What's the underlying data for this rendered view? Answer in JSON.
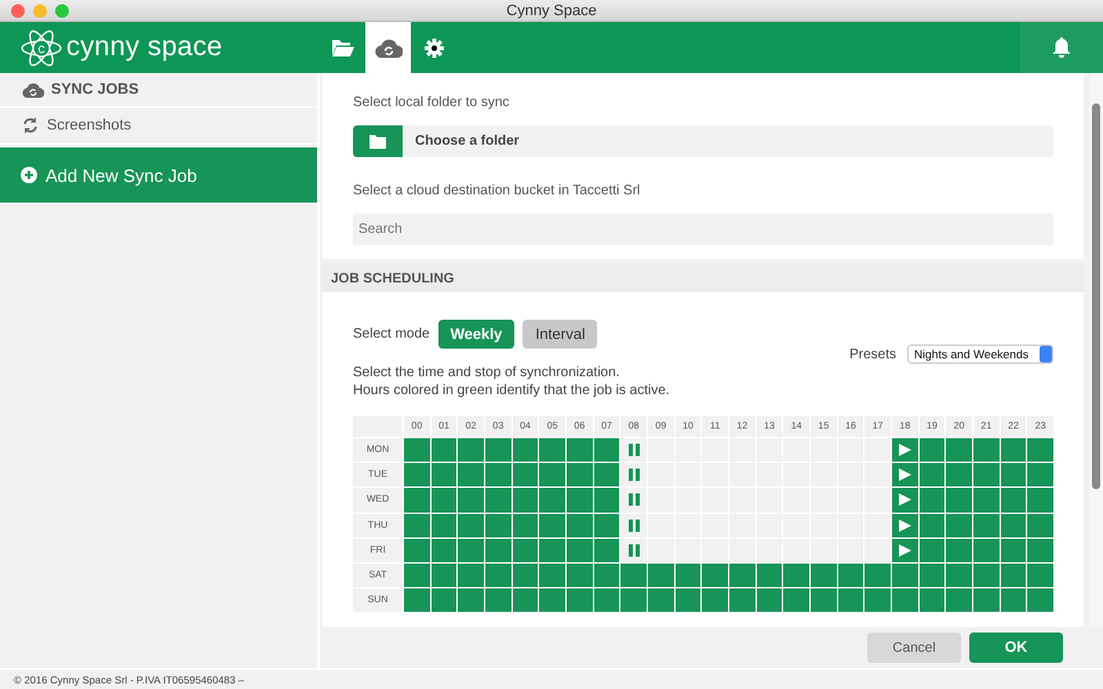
{
  "window": {
    "title": "Cynny Space"
  },
  "header": {
    "logo": {
      "mark": "c",
      "text": "cynny space"
    },
    "tabs": [
      {
        "kind": "folder",
        "selected": false
      },
      {
        "kind": "cloud",
        "selected": true
      },
      {
        "kind": "gear",
        "selected": false
      }
    ]
  },
  "sidebar": {
    "heading": "SYNC JOBS",
    "items": [
      {
        "label": "Screenshots",
        "selected": false
      }
    ],
    "add_button": "Add New Sync Job"
  },
  "source": {
    "folder_label": "Select local folder to sync",
    "folder_button": "Choose a folder",
    "bucket_label": "Select a cloud destination bucket in Taccetti Srl",
    "search": {
      "placeholder": "Search"
    }
  },
  "scheduling": {
    "title": "JOB SCHEDULING",
    "mode_label": "Select mode",
    "modes": [
      {
        "label": "Weekly",
        "selected": true
      },
      {
        "label": "Interval",
        "selected": false
      }
    ],
    "presets_label": "Presets",
    "preset": "Nights and Weekends",
    "description": [
      "Select the time and stop of synchronization.",
      "Hours colored in green identify that the job is active."
    ],
    "hours": [
      "00",
      "01",
      "02",
      "03",
      "04",
      "05",
      "06",
      "07",
      "08",
      "09",
      "10",
      "11",
      "12",
      "13",
      "14",
      "15",
      "16",
      "17",
      "18",
      "19",
      "20",
      "21",
      "22",
      "23"
    ],
    "rows": [
      {
        "day": "MON",
        "hours": [
          {
            "on": true
          },
          {
            "on": true
          },
          {
            "on": true
          },
          {
            "on": true
          },
          {
            "on": true
          },
          {
            "on": true
          },
          {
            "on": true
          },
          {
            "on": true
          },
          {
            "on": false,
            "kind": "stop"
          },
          {
            "on": false
          },
          {
            "on": false
          },
          {
            "on": false
          },
          {
            "on": false
          },
          {
            "on": false
          },
          {
            "on": false
          },
          {
            "on": false
          },
          {
            "on": false
          },
          {
            "on": false
          },
          {
            "on": true,
            "kind": "start"
          },
          {
            "on": true
          },
          {
            "on": true
          },
          {
            "on": true
          },
          {
            "on": true
          },
          {
            "on": true
          }
        ]
      },
      {
        "day": "TUE",
        "hours": [
          {
            "on": true
          },
          {
            "on": true
          },
          {
            "on": true
          },
          {
            "on": true
          },
          {
            "on": true
          },
          {
            "on": true
          },
          {
            "on": true
          },
          {
            "on": true
          },
          {
            "on": false,
            "kind": "stop"
          },
          {
            "on": false
          },
          {
            "on": false
          },
          {
            "on": false
          },
          {
            "on": false
          },
          {
            "on": false
          },
          {
            "on": false
          },
          {
            "on": false
          },
          {
            "on": false
          },
          {
            "on": false
          },
          {
            "on": true,
            "kind": "start"
          },
          {
            "on": true
          },
          {
            "on": true
          },
          {
            "on": true
          },
          {
            "on": true
          },
          {
            "on": true
          }
        ]
      },
      {
        "day": "WED",
        "hours": [
          {
            "on": true
          },
          {
            "on": true
          },
          {
            "on": true
          },
          {
            "on": true
          },
          {
            "on": true
          },
          {
            "on": true
          },
          {
            "on": true
          },
          {
            "on": true
          },
          {
            "on": false,
            "kind": "stop"
          },
          {
            "on": false
          },
          {
            "on": false
          },
          {
            "on": false
          },
          {
            "on": false
          },
          {
            "on": false
          },
          {
            "on": false
          },
          {
            "on": false
          },
          {
            "on": false
          },
          {
            "on": false
          },
          {
            "on": true,
            "kind": "start"
          },
          {
            "on": true
          },
          {
            "on": true
          },
          {
            "on": true
          },
          {
            "on": true
          },
          {
            "on": true
          }
        ]
      },
      {
        "day": "THU",
        "hours": [
          {
            "on": true
          },
          {
            "on": true
          },
          {
            "on": true
          },
          {
            "on": true
          },
          {
            "on": true
          },
          {
            "on": true
          },
          {
            "on": true
          },
          {
            "on": true
          },
          {
            "on": false,
            "kind": "stop"
          },
          {
            "on": false
          },
          {
            "on": false
          },
          {
            "on": false
          },
          {
            "on": false
          },
          {
            "on": false
          },
          {
            "on": false
          },
          {
            "on": false
          },
          {
            "on": false
          },
          {
            "on": false
          },
          {
            "on": true,
            "kind": "start"
          },
          {
            "on": true
          },
          {
            "on": true
          },
          {
            "on": true
          },
          {
            "on": true
          },
          {
            "on": true
          }
        ]
      },
      {
        "day": "FRI",
        "hours": [
          {
            "on": true
          },
          {
            "on": true
          },
          {
            "on": true
          },
          {
            "on": true
          },
          {
            "on": true
          },
          {
            "on": true
          },
          {
            "on": true
          },
          {
            "on": true
          },
          {
            "on": false,
            "kind": "stop"
          },
          {
            "on": false
          },
          {
            "on": false
          },
          {
            "on": false
          },
          {
            "on": false
          },
          {
            "on": false
          },
          {
            "on": false
          },
          {
            "on": false
          },
          {
            "on": false
          },
          {
            "on": false
          },
          {
            "on": true,
            "kind": "start"
          },
          {
            "on": true
          },
          {
            "on": true
          },
          {
            "on": true
          },
          {
            "on": true
          },
          {
            "on": true
          }
        ]
      },
      {
        "day": "SAT",
        "hours": [
          {
            "on": true
          },
          {
            "on": true
          },
          {
            "on": true
          },
          {
            "on": true
          },
          {
            "on": true
          },
          {
            "on": true
          },
          {
            "on": true
          },
          {
            "on": true
          },
          {
            "on": true
          },
          {
            "on": true
          },
          {
            "on": true
          },
          {
            "on": true
          },
          {
            "on": true
          },
          {
            "on": true
          },
          {
            "on": true
          },
          {
            "on": true
          },
          {
            "on": true
          },
          {
            "on": true
          },
          {
            "on": true
          },
          {
            "on": true
          },
          {
            "on": true
          },
          {
            "on": true
          },
          {
            "on": true
          },
          {
            "on": true
          }
        ]
      },
      {
        "day": "SUN",
        "hours": [
          {
            "on": true
          },
          {
            "on": true
          },
          {
            "on": true
          },
          {
            "on": true
          },
          {
            "on": true
          },
          {
            "on": true
          },
          {
            "on": true
          },
          {
            "on": true
          },
          {
            "on": true
          },
          {
            "on": true
          },
          {
            "on": true
          },
          {
            "on": true
          },
          {
            "on": true
          },
          {
            "on": true
          },
          {
            "on": true
          },
          {
            "on": true
          },
          {
            "on": true
          },
          {
            "on": true
          },
          {
            "on": true
          },
          {
            "on": true
          },
          {
            "on": true
          },
          {
            "on": true
          },
          {
            "on": true
          },
          {
            "on": true
          }
        ]
      }
    ]
  },
  "actions": {
    "cancel": "Cancel",
    "ok": "OK"
  },
  "footer": "© 2016 Cynny Space Srl - P.IVA IT06595460483 –"
}
